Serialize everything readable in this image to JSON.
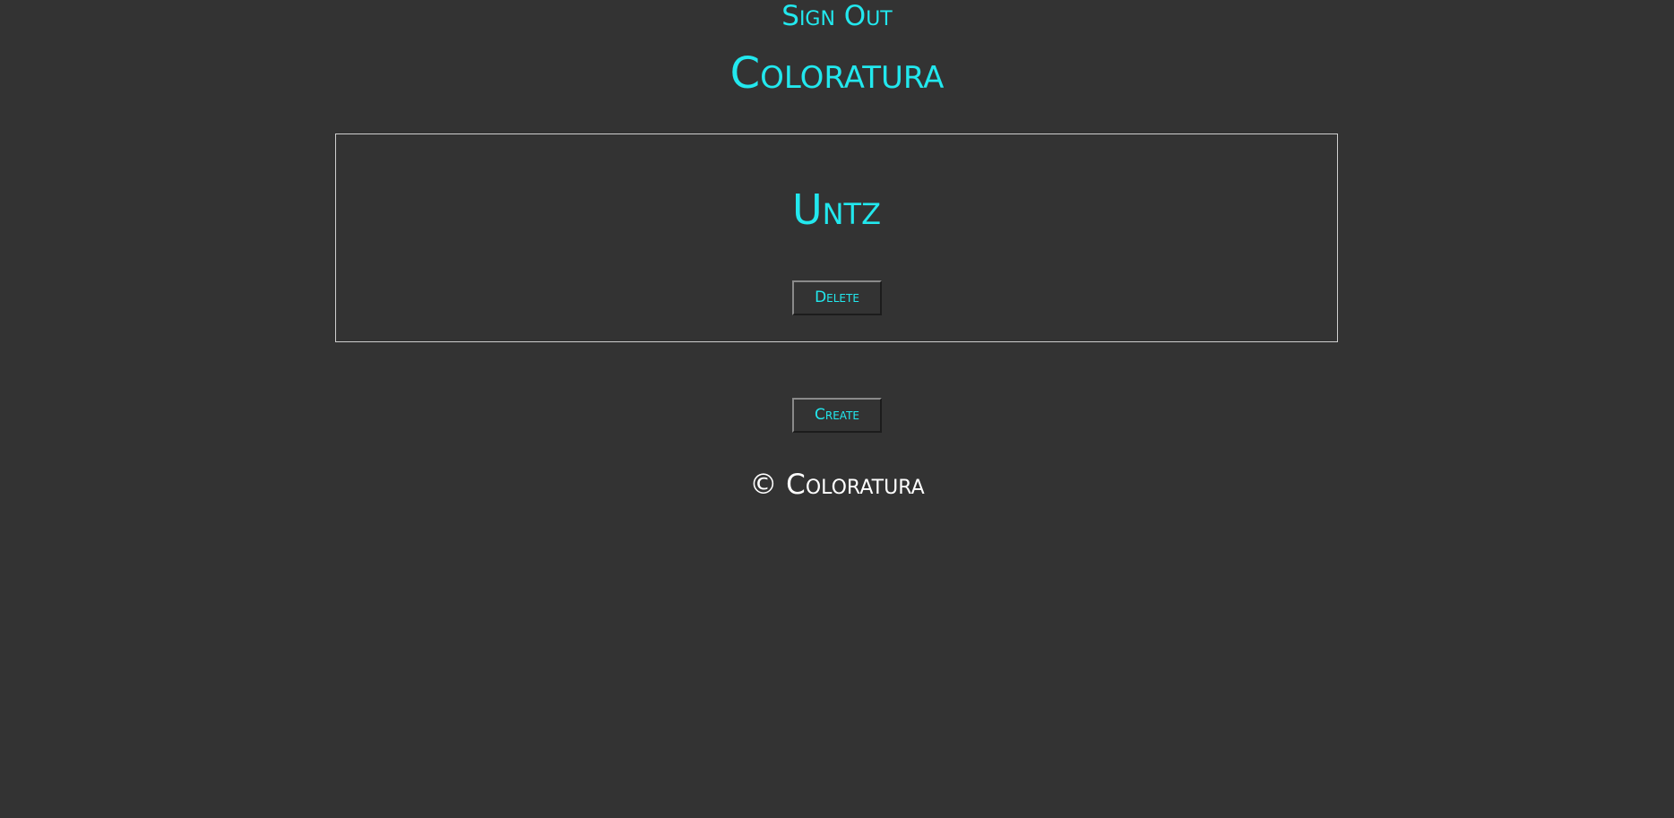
{
  "header": {
    "sign_out_label": "Sign Out",
    "app_title": "Coloratura"
  },
  "main": {
    "items": [
      {
        "title": "Untz",
        "delete_label": "Delete"
      }
    ],
    "create_label": "Create"
  },
  "footer": {
    "copyright": "© Coloratura"
  },
  "colors": {
    "background": "#333333",
    "accent": "#22e8ee",
    "footer_text": "#ffffff",
    "card_border": "#cfcfcf"
  }
}
